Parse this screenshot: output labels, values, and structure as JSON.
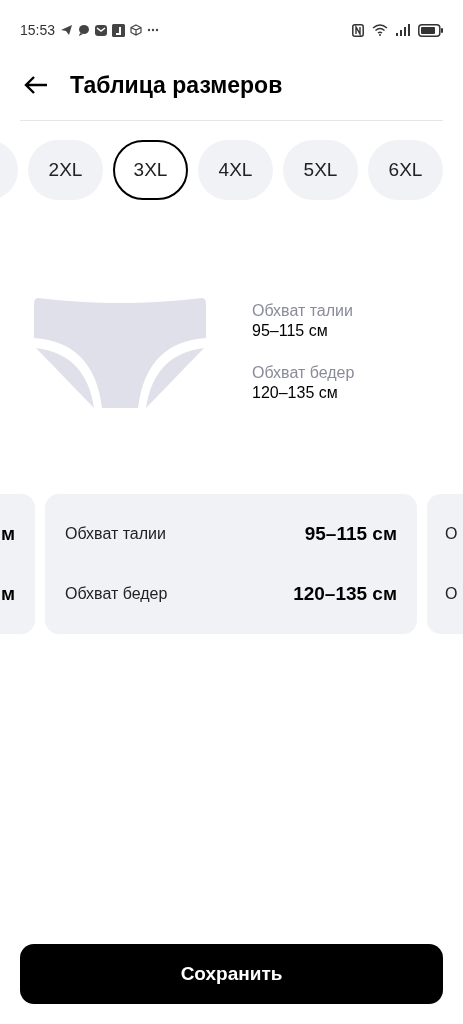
{
  "status_bar": {
    "time": "15:53"
  },
  "header": {
    "title": "Таблица размеров"
  },
  "sizes": [
    {
      "selected": false,
      "kind": "partial"
    },
    {
      "label": "2XL",
      "selected": false,
      "kind": "chip"
    },
    {
      "label": "3XL",
      "selected": true,
      "kind": "chip"
    },
    {
      "label": "4XL",
      "selected": false,
      "kind": "chip"
    },
    {
      "label": "5XL",
      "selected": false,
      "kind": "chip"
    },
    {
      "label": "6XL",
      "selected": false,
      "kind": "chip"
    }
  ],
  "measurements": [
    {
      "label": "Обхват талии",
      "value": "95–115 см"
    },
    {
      "label": "Обхват бедер",
      "value": "120–135 см"
    }
  ],
  "cards": [
    {
      "kind": "partial-left",
      "rows": [
        {
          "value": "м"
        },
        {
          "value": "м"
        }
      ]
    },
    {
      "kind": "full",
      "rows": [
        {
          "label": "Обхват талии",
          "value": "95–115 см"
        },
        {
          "label": "Обхват бедер",
          "value": "120–135 см"
        }
      ]
    },
    {
      "kind": "partial-right",
      "rows": [
        {
          "label": "О"
        },
        {
          "label": "О"
        }
      ]
    }
  ],
  "save_button": {
    "label": "Сохранить"
  }
}
